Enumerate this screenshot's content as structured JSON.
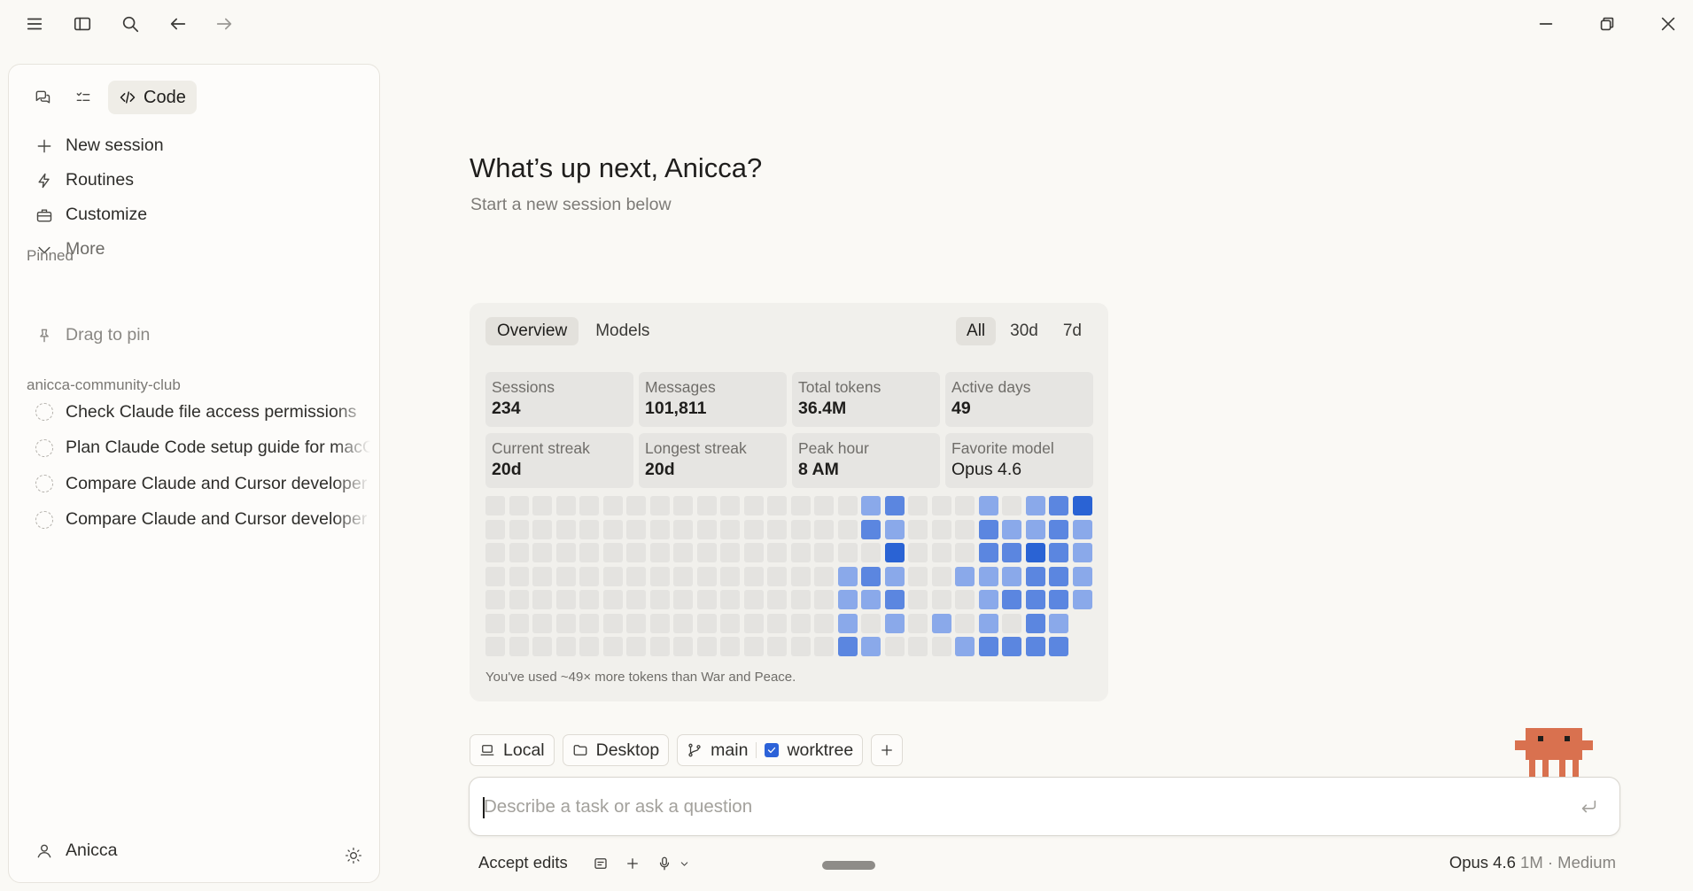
{
  "titlebar": {
    "icons": [
      "menu-icon",
      "sidebar-toggle-icon",
      "search-icon",
      "back-icon",
      "forward-icon",
      "minimize-icon",
      "restore-icon",
      "close-icon"
    ]
  },
  "sidebar": {
    "mode_code_label": "Code",
    "nav": [
      {
        "label": "New session",
        "icon": "plus-icon"
      },
      {
        "label": "Routines",
        "icon": "bolt-icon"
      },
      {
        "label": "Customize",
        "icon": "briefcase-icon"
      },
      {
        "label": "More",
        "icon": "chevron-down-icon"
      }
    ],
    "pinned_label": "Pinned",
    "drag_to_pin": "Drag to pin",
    "project_label": "anicca-community-club",
    "sessions": [
      "Check Claude file access permissions",
      "Plan Claude Code setup guide for macOS",
      "Compare Claude and Cursor developer tools",
      "Compare Claude and Cursor developer workflows"
    ],
    "user_name": "Anicca"
  },
  "main": {
    "headline": "What’s up next, Anicca?",
    "subline": "Start a new session below"
  },
  "stats": {
    "tabs": [
      "Overview",
      "Models"
    ],
    "ranges": [
      "All",
      "30d",
      "7d"
    ],
    "cards": [
      {
        "label": "Sessions",
        "value": "234"
      },
      {
        "label": "Messages",
        "value": "101,811"
      },
      {
        "label": "Total tokens",
        "value": "36.4M"
      },
      {
        "label": "Active days",
        "value": "49"
      },
      {
        "label": "Current streak",
        "value": "20d"
      },
      {
        "label": "Longest streak",
        "value": "20d"
      },
      {
        "label": "Peak hour",
        "value": "8 AM"
      },
      {
        "label": "Favorite model",
        "value": "Opus 4.6"
      }
    ],
    "footnote": "You've used ~49× more tokens than War and Peace.",
    "activity_levels": [
      [
        0,
        0,
        0,
        0,
        0,
        0,
        0,
        0,
        0,
        0,
        0,
        0,
        0,
        0,
        0,
        0,
        2,
        3,
        0,
        0,
        0,
        2,
        0,
        2,
        3,
        4
      ],
      [
        0,
        0,
        0,
        0,
        0,
        0,
        0,
        0,
        0,
        0,
        0,
        0,
        0,
        0,
        0,
        0,
        3,
        2,
        0,
        0,
        0,
        3,
        2,
        2,
        3,
        2
      ],
      [
        0,
        0,
        0,
        0,
        0,
        0,
        0,
        0,
        0,
        0,
        0,
        0,
        0,
        0,
        0,
        0,
        0,
        4,
        0,
        0,
        0,
        3,
        3,
        4,
        3,
        2
      ],
      [
        0,
        0,
        0,
        0,
        0,
        0,
        0,
        0,
        0,
        0,
        0,
        0,
        0,
        0,
        0,
        2,
        3,
        2,
        0,
        0,
        2,
        2,
        2,
        3,
        3,
        2
      ],
      [
        0,
        0,
        0,
        0,
        0,
        0,
        0,
        0,
        0,
        0,
        0,
        0,
        0,
        0,
        0,
        2,
        2,
        3,
        0,
        0,
        0,
        2,
        3,
        3,
        3,
        2
      ],
      [
        0,
        0,
        0,
        0,
        0,
        0,
        0,
        0,
        0,
        0,
        0,
        0,
        0,
        0,
        0,
        2,
        0,
        2,
        0,
        2,
        0,
        2,
        0,
        3,
        2,
        -1
      ],
      [
        0,
        0,
        0,
        0,
        0,
        0,
        0,
        0,
        0,
        0,
        0,
        0,
        0,
        0,
        0,
        3,
        2,
        0,
        0,
        0,
        2,
        3,
        3,
        3,
        3,
        -1
      ]
    ],
    "level_colors": [
      "#e4e3e0",
      "#a9c1f0",
      "#8aa9ea",
      "#5b86e0",
      "#2a63d4"
    ]
  },
  "composer": {
    "chips": {
      "local": "Local",
      "folder": "Desktop",
      "branch": "main",
      "worktree": "worktree"
    },
    "placeholder": "Describe a task or ask a question",
    "accept_edits": "Accept edits",
    "model_name": "Opus 4.6",
    "model_detail": "1M · Medium"
  }
}
